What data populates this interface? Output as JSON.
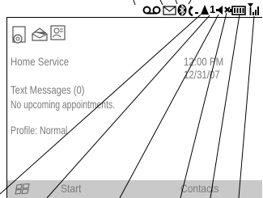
{
  "home": {
    "service": "Home Service",
    "time": "12:00 PM",
    "date": "12/31/07",
    "text_messages": "Text Messages (0)",
    "appointments": "No upcoming appointments.",
    "profile": "Profile: Normal"
  },
  "softkeys": {
    "left": "Start",
    "right": "Contacts"
  },
  "status_bar": {
    "line_number": "1",
    "icons": [
      "voicemail-icon",
      "message-envelope-icon",
      "bluetooth-icon",
      "call-forward-icon",
      "roaming-icon",
      "line-indicator",
      "speaker-icon",
      "vibrate-silent-icon",
      "battery-icon",
      "signal-strength-icon"
    ]
  },
  "shortcut_icons": [
    "settings-icon",
    "messaging-icon",
    "contacts-card-icon"
  ],
  "colors": {
    "bottom_bar": "#c9c9c9",
    "text": "#7c7c7c",
    "outline": "#000000"
  }
}
